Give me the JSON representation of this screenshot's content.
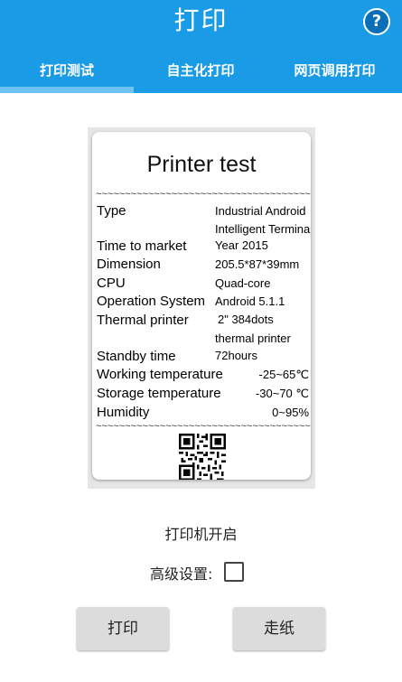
{
  "colors": {
    "accent": "#1a9be6",
    "indicator": "#6ec3f5",
    "button": "#dcdcdc"
  },
  "header": {
    "title": "打印",
    "help_icon": "help-icon",
    "help_glyph": "?"
  },
  "tabs": [
    {
      "label": "打印测试",
      "selected": true
    },
    {
      "label": "自主化打印",
      "selected": false
    },
    {
      "label": "网页调用打印",
      "selected": false
    }
  ],
  "receipt": {
    "title": "Printer test",
    "divider": "~~~~~~~~~~~~~~~~~~~~~~~~~~~~~~~~~~~~~~~~",
    "rows": [
      {
        "label": "Type",
        "value": "Industrial Android",
        "value2": "Intelligent Terminal"
      },
      {
        "label": "Time to market",
        "value": "Year 2015"
      },
      {
        "label": "Dimension",
        "value": "205.5*87*39mm"
      },
      {
        "label": "CPU",
        "value": "Quad-core"
      },
      {
        "label": "Operation System",
        "value": "Android 5.1.1"
      },
      {
        "label": "Thermal printer",
        "value": "2\" 384dots",
        "value2": "thermal printer"
      },
      {
        "label": "Standby time",
        "value": "72hours"
      },
      {
        "label": "Working temperature",
        "value": "-25~65℃"
      },
      {
        "label": "Storage temperature",
        "value": "-30~70 ℃"
      },
      {
        "label": "Humidity",
        "value": "0~95%"
      }
    ],
    "qr_icon": "qr-code-icon"
  },
  "status": "打印机开启",
  "advanced": {
    "label": "高级设置:",
    "checked": false
  },
  "buttons": {
    "print": "打印",
    "feed": "走纸"
  }
}
